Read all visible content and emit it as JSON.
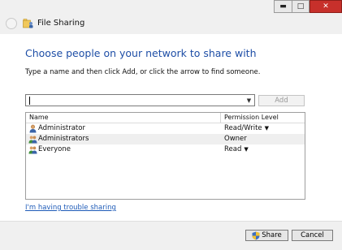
{
  "window": {
    "title": "File Sharing",
    "controls": {
      "minimize": "▬",
      "maximize": "□",
      "close": "✕"
    }
  },
  "heading": "Choose people on your network to share with",
  "instruction": "Type a name and then click Add, or click the arrow to find someone.",
  "name_input": {
    "value": "",
    "placeholder": ""
  },
  "add_button": "Add",
  "table": {
    "columns": [
      "Name",
      "Permission Level"
    ],
    "rows": [
      {
        "name": "Administrator",
        "level": "Read/Write",
        "has_dropdown": true,
        "icon": "user-icon"
      },
      {
        "name": "Administrators",
        "level": "Owner",
        "has_dropdown": false,
        "icon": "group-icon"
      },
      {
        "name": "Everyone",
        "level": "Read",
        "has_dropdown": true,
        "icon": "group-icon"
      }
    ]
  },
  "trouble_link": "I'm having trouble sharing",
  "buttons": {
    "share": "Share",
    "cancel": "Cancel"
  },
  "colors": {
    "accent_blue": "#1e4ea6",
    "link_blue": "#1e5bb8",
    "close_red": "#c7302b"
  }
}
